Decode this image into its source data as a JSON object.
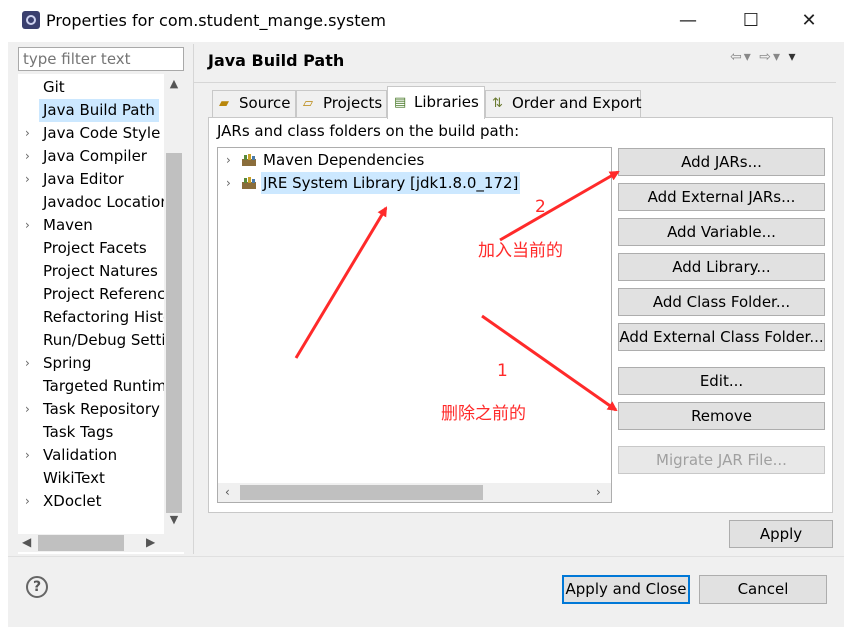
{
  "window": {
    "title": "Properties for com.student_mange.system",
    "minimize_glyph": "—",
    "maximize_glyph": "☐",
    "close_glyph": "✕"
  },
  "sidebar": {
    "filter_placeholder": "type filter text",
    "items": [
      {
        "label": "Git",
        "expandable": false
      },
      {
        "label": "Java Build Path",
        "expandable": false,
        "selected": true
      },
      {
        "label": "Java Code Style",
        "expandable": true
      },
      {
        "label": "Java Compiler",
        "expandable": true
      },
      {
        "label": "Java Editor",
        "expandable": true
      },
      {
        "label": "Javadoc Location",
        "expandable": false
      },
      {
        "label": "Maven",
        "expandable": true
      },
      {
        "label": "Project Facets",
        "expandable": false
      },
      {
        "label": "Project Natures",
        "expandable": false
      },
      {
        "label": "Project References",
        "expandable": false
      },
      {
        "label": "Refactoring History",
        "expandable": false
      },
      {
        "label": "Run/Debug Settings",
        "expandable": false
      },
      {
        "label": "Spring",
        "expandable": true
      },
      {
        "label": "Targeted Runtimes",
        "expandable": false
      },
      {
        "label": "Task Repository",
        "expandable": true
      },
      {
        "label": "Task Tags",
        "expandable": false
      },
      {
        "label": "Validation",
        "expandable": true
      },
      {
        "label": "WikiText",
        "expandable": false
      },
      {
        "label": "XDoclet",
        "expandable": true
      }
    ]
  },
  "page": {
    "title": "Java Build Path",
    "tabs": [
      {
        "label": "Source",
        "icon": "source-folder-icon"
      },
      {
        "label": "Projects",
        "icon": "projects-icon"
      },
      {
        "label": "Libraries",
        "icon": "libraries-icon",
        "active": true
      },
      {
        "label": "Order and Export",
        "icon": "order-export-icon"
      }
    ],
    "list_label": "JARs and class folders on the build path:",
    "libraries": [
      {
        "label": "Maven Dependencies",
        "selected": false
      },
      {
        "label": "JRE System Library [jdk1.8.0_172]",
        "selected": true
      }
    ],
    "buttons": {
      "add_jars": "Add JARs...",
      "add_external_jars": "Add External JARs...",
      "add_variable": "Add Variable...",
      "add_library": "Add Library...",
      "add_class_folder": "Add Class Folder...",
      "add_external_class_folder": "Add External Class Folder...",
      "edit": "Edit...",
      "remove": "Remove",
      "migrate_jar": "Migrate JAR File..."
    },
    "apply_label": "Apply"
  },
  "footer": {
    "help_glyph": "?",
    "apply_close_label": "Apply and Close",
    "cancel_label": "Cancel"
  },
  "annotations": {
    "step2_number": "2",
    "step2_text": "加入当前的",
    "step1_number": "1",
    "step1_text": "删除之前的",
    "color": "#ff2a2a"
  },
  "colors": {
    "selection": "#cce8ff",
    "default_button_border": "#0078d7",
    "dialog_background": "#f0f0f0"
  }
}
